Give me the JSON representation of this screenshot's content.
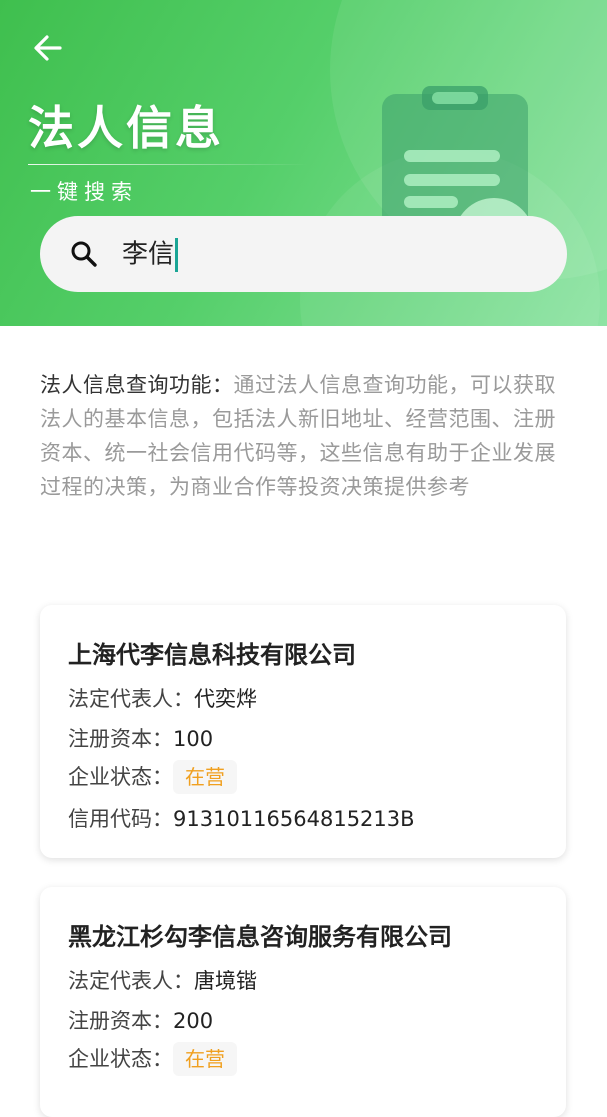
{
  "header": {
    "title": "法人信息",
    "subtitle": "一键搜索",
    "back_icon": "arrow-left-icon",
    "illustration_icon": "clipboard-icon"
  },
  "search": {
    "value": "李信",
    "icon": "search-icon"
  },
  "intro": {
    "label": "法人信息查询功能：",
    "text": "通过法人信息查询功能，可以获取法人的基本信息，包括法人新旧地址、经营范围、注册资本、统一社会信用代码等，这些信息有助于企业发展过程的决策，为商业合作等投资决策提供参考"
  },
  "results": [
    {
      "company": "上海代李信息科技有限公司",
      "rep_label": "法定代表人：",
      "rep": "代奕烨",
      "capital_label": "注册资本：",
      "capital": "100",
      "status_label": "企业状态：",
      "status": "在营",
      "code_label": "信用代码：",
      "code": "91310116564815213B"
    },
    {
      "company": "黑龙江杉勾李信息咨询服务有限公司",
      "rep_label": "法定代表人：",
      "rep": "唐境锴",
      "capital_label": "注册资本：",
      "capital": "200",
      "status_label": "企业状态：",
      "status": "在营"
    }
  ],
  "colors": {
    "header_start": "#3fbf4e",
    "header_end": "#8ee3a4",
    "status_text": "#f0a020",
    "caret": "#1aa595"
  }
}
